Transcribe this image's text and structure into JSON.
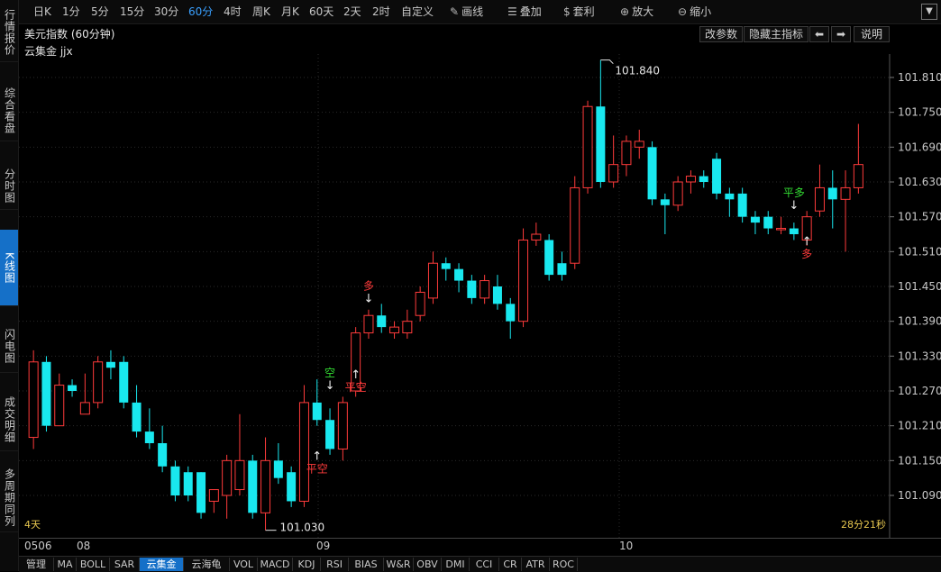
{
  "left_tabs": [
    "行情报价",
    "综合看盘",
    "分时图",
    "K线图",
    "闪电图",
    "成交明细",
    "多周期同列"
  ],
  "left_tab_active": "K线图",
  "period_tabs": [
    "日K",
    "1分",
    "5分",
    "15分",
    "30分",
    "60分",
    "4时",
    "周K",
    "月K",
    "60天",
    "2天",
    "2时",
    "自定义"
  ],
  "period_active": "60分",
  "tools": [
    {
      "label": "画线",
      "icon": "pen-icon"
    },
    {
      "label": "叠加",
      "icon": "stack-icon"
    },
    {
      "label": "套利",
      "icon": "money-bag-icon"
    },
    {
      "label": "放大",
      "icon": "zoom-in-icon"
    },
    {
      "label": "缩小",
      "icon": "zoom-out-icon"
    }
  ],
  "chart_title": "美元指数 (60分钟)",
  "header_buttons": {
    "modify_params": "改参数",
    "hide_main_indicator": "隐藏主指标",
    "explain": "说明"
  },
  "indicator_name": "云集金 jjx",
  "chart_data": {
    "type": "candlestick",
    "ylim": [
      101.03,
      101.86
    ],
    "y_ticks": [
      "101.810",
      "101.750",
      "101.690",
      "101.630",
      "101.570",
      "101.510",
      "101.450",
      "101.390",
      "101.330",
      "101.270",
      "101.210",
      "101.150",
      "101.090"
    ],
    "x_labels": [
      "0506",
      "08",
      "09",
      "10"
    ],
    "colors": {
      "up": "#ff3b3b",
      "down": "#19e8ef",
      "signal_green": "#33dd33",
      "signal_red": "#ff3b3b",
      "grid": "#2a2a2a"
    },
    "candles": [
      {
        "o": 101.19,
        "c": 101.32,
        "h": 101.34,
        "l": 101.17
      },
      {
        "o": 101.32,
        "c": 101.21,
        "h": 101.33,
        "l": 101.2
      },
      {
        "o": 101.21,
        "c": 101.28,
        "h": 101.3,
        "l": 101.21
      },
      {
        "o": 101.28,
        "c": 101.27,
        "h": 101.29,
        "l": 101.26
      },
      {
        "o": 101.23,
        "c": 101.25,
        "h": 101.3,
        "l": 101.23
      },
      {
        "o": 101.25,
        "c": 101.32,
        "h": 101.33,
        "l": 101.24
      },
      {
        "o": 101.32,
        "c": 101.31,
        "h": 101.34,
        "l": 101.29
      },
      {
        "o": 101.32,
        "c": 101.25,
        "h": 101.33,
        "l": 101.24
      },
      {
        "o": 101.25,
        "c": 101.2,
        "h": 101.28,
        "l": 101.19
      },
      {
        "o": 101.2,
        "c": 101.18,
        "h": 101.24,
        "l": 101.17
      },
      {
        "o": 101.18,
        "c": 101.14,
        "h": 101.21,
        "l": 101.13
      },
      {
        "o": 101.14,
        "c": 101.09,
        "h": 101.15,
        "l": 101.08
      },
      {
        "o": 101.13,
        "c": 101.09,
        "h": 101.14,
        "l": 101.08
      },
      {
        "o": 101.13,
        "c": 101.06,
        "h": 101.13,
        "l": 101.05
      },
      {
        "o": 101.08,
        "c": 101.1,
        "h": 101.1,
        "l": 101.06
      },
      {
        "o": 101.09,
        "c": 101.15,
        "h": 101.16,
        "l": 101.05
      },
      {
        "o": 101.1,
        "c": 101.15,
        "h": 101.23,
        "l": 101.09
      },
      {
        "o": 101.15,
        "c": 101.06,
        "h": 101.16,
        "l": 101.05
      },
      {
        "o": 101.06,
        "c": 101.15,
        "h": 101.19,
        "l": 101.03
      },
      {
        "o": 101.15,
        "c": 101.12,
        "h": 101.18,
        "l": 101.11
      },
      {
        "o": 101.13,
        "c": 101.08,
        "h": 101.14,
        "l": 101.07
      },
      {
        "o": 101.08,
        "c": 101.25,
        "h": 101.28,
        "l": 101.07
      },
      {
        "o": 101.25,
        "c": 101.22,
        "h": 101.29,
        "l": 101.21
      },
      {
        "o": 101.22,
        "c": 101.17,
        "h": 101.24,
        "l": 101.16
      },
      {
        "o": 101.17,
        "c": 101.25,
        "h": 101.26,
        "l": 101.15
      },
      {
        "o": 101.27,
        "c": 101.37,
        "h": 101.38,
        "l": 101.26
      },
      {
        "o": 101.37,
        "c": 101.4,
        "h": 101.41,
        "l": 101.36
      },
      {
        "o": 101.4,
        "c": 101.38,
        "h": 101.42,
        "l": 101.37
      },
      {
        "o": 101.37,
        "c": 101.38,
        "h": 101.39,
        "l": 101.36
      },
      {
        "o": 101.37,
        "c": 101.39,
        "h": 101.41,
        "l": 101.36
      },
      {
        "o": 101.4,
        "c": 101.44,
        "h": 101.45,
        "l": 101.39
      },
      {
        "o": 101.43,
        "c": 101.49,
        "h": 101.51,
        "l": 101.42
      },
      {
        "o": 101.49,
        "c": 101.48,
        "h": 101.5,
        "l": 101.46
      },
      {
        "o": 101.48,
        "c": 101.46,
        "h": 101.49,
        "l": 101.44
      },
      {
        "o": 101.46,
        "c": 101.43,
        "h": 101.47,
        "l": 101.42
      },
      {
        "o": 101.43,
        "c": 101.46,
        "h": 101.47,
        "l": 101.42
      },
      {
        "o": 101.45,
        "c": 101.42,
        "h": 101.47,
        "l": 101.41
      },
      {
        "o": 101.42,
        "c": 101.39,
        "h": 101.43,
        "l": 101.36
      },
      {
        "o": 101.39,
        "c": 101.53,
        "h": 101.55,
        "l": 101.38
      },
      {
        "o": 101.53,
        "c": 101.54,
        "h": 101.56,
        "l": 101.52
      },
      {
        "o": 101.53,
        "c": 101.47,
        "h": 101.54,
        "l": 101.46
      },
      {
        "o": 101.49,
        "c": 101.47,
        "h": 101.51,
        "l": 101.46
      },
      {
        "o": 101.49,
        "c": 101.62,
        "h": 101.64,
        "l": 101.48
      },
      {
        "o": 101.62,
        "c": 101.76,
        "h": 101.77,
        "l": 101.61
      },
      {
        "o": 101.76,
        "c": 101.63,
        "h": 101.84,
        "l": 101.62
      },
      {
        "o": 101.63,
        "c": 101.66,
        "h": 101.71,
        "l": 101.62
      },
      {
        "o": 101.66,
        "c": 101.7,
        "h": 101.71,
        "l": 101.64
      },
      {
        "o": 101.69,
        "c": 101.7,
        "h": 101.72,
        "l": 101.67
      },
      {
        "o": 101.69,
        "c": 101.6,
        "h": 101.7,
        "l": 101.59
      },
      {
        "o": 101.6,
        "c": 101.59,
        "h": 101.61,
        "l": 101.54
      },
      {
        "o": 101.59,
        "c": 101.63,
        "h": 101.64,
        "l": 101.58
      },
      {
        "o": 101.63,
        "c": 101.64,
        "h": 101.65,
        "l": 101.61
      },
      {
        "o": 101.64,
        "c": 101.63,
        "h": 101.65,
        "l": 101.62
      },
      {
        "o": 101.67,
        "c": 101.61,
        "h": 101.68,
        "l": 101.6
      },
      {
        "o": 101.61,
        "c": 101.6,
        "h": 101.62,
        "l": 101.57
      },
      {
        "o": 101.61,
        "c": 101.57,
        "h": 101.62,
        "l": 101.56
      },
      {
        "o": 101.57,
        "c": 101.56,
        "h": 101.58,
        "l": 101.54
      },
      {
        "o": 101.57,
        "c": 101.55,
        "h": 101.58,
        "l": 101.54
      },
      {
        "o": 101.55,
        "c": 101.55,
        "h": 101.57,
        "l": 101.54
      },
      {
        "o": 101.55,
        "c": 101.54,
        "h": 101.56,
        "l": 101.53
      },
      {
        "o": 101.53,
        "c": 101.57,
        "h": 101.58,
        "l": 101.52
      },
      {
        "o": 101.58,
        "c": 101.62,
        "h": 101.66,
        "l": 101.57
      },
      {
        "o": 101.62,
        "c": 101.6,
        "h": 101.65,
        "l": 101.55
      },
      {
        "o": 101.6,
        "c": 101.62,
        "h": 101.65,
        "l": 101.51
      },
      {
        "o": 101.62,
        "c": 101.66,
        "h": 101.73,
        "l": 101.61
      }
    ],
    "annotations": {
      "high": "101.840",
      "low": "101.030"
    },
    "signals": [
      {
        "text": "平空",
        "idx": 22,
        "color": "red",
        "dir": "up",
        "price": 101.17
      },
      {
        "text": "空",
        "idx": 23,
        "color": "green",
        "dir": "down",
        "price": 101.27
      },
      {
        "text": "平空",
        "idx": 25,
        "color": "red",
        "dir": "up",
        "price": 101.31
      },
      {
        "text": "多",
        "idx": 26,
        "color": "red",
        "dir": "down",
        "price": 101.42
      },
      {
        "text": "平多",
        "idx": 59,
        "color": "green",
        "dir": "down",
        "price": 101.58
      },
      {
        "text": "多",
        "idx": 60,
        "color": "red",
        "dir": "up",
        "price": 101.54
      }
    ]
  },
  "corner_left": "4天",
  "corner_right": "28分21秒",
  "bottom_tabs": [
    "管理",
    "MA",
    "BOLL",
    "SAR",
    "云集金",
    "云海龟",
    "VOL",
    "MACD",
    "KDJ",
    "RSI",
    "BIAS",
    "W&R",
    "OBV",
    "DMI",
    "CCI",
    "CR",
    "ATR",
    "ROC"
  ],
  "bottom_active": "云集金"
}
